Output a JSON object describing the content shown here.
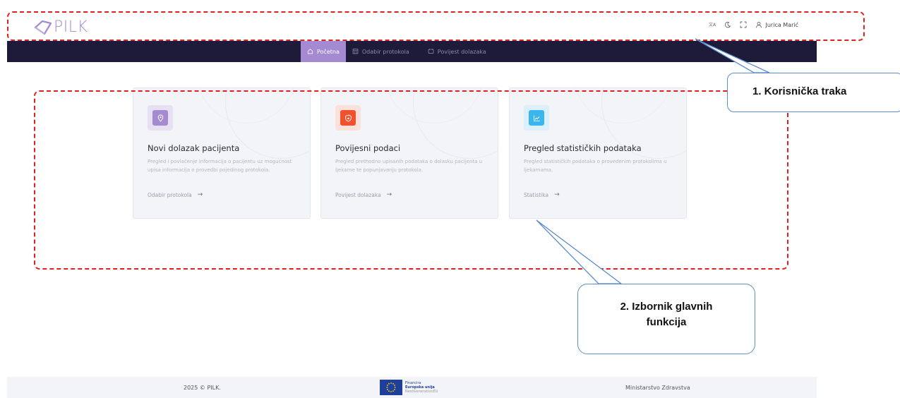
{
  "app": {
    "logo_text": "PILK"
  },
  "header": {
    "user_name": "Jurica Marić",
    "icons": [
      "translate-icon",
      "moon-icon",
      "fullscreen-icon",
      "user-icon"
    ]
  },
  "nav": {
    "items": [
      {
        "label": "Početna",
        "icon": "home-icon",
        "active": true
      },
      {
        "label": "Odabir protokola",
        "icon": "calendar-icon",
        "active": false
      },
      {
        "label": "Povijest dolazaka",
        "icon": "history-icon",
        "active": false
      }
    ]
  },
  "cards": [
    {
      "title": "Novi dolazak pacijenta",
      "description": "Pregled i povlačenje informacija o pacijentu uz mogućnost upisa informacija o provedbi pojedinog protokola.",
      "link": "Odabir protokola",
      "icon": "location-pin-icon",
      "icon_bg": "#e7e0f2",
      "icon_color": "#a48ad0"
    },
    {
      "title": "Povijesni podaci",
      "description": "Pregled prethodno upisanih podataka o dolasku pacijenta u ljekarne te popunjavanju protokola.",
      "link": "Povijest dolazaka",
      "icon": "shield-icon",
      "icon_bg": "#fbe1dc",
      "icon_color": "#f2512d"
    },
    {
      "title": "Pregled statističkih podataka",
      "description": "Pregled statističkih podataka o provedenim protokolima u ljekarnama.",
      "link": "Statistika",
      "icon": "chart-line-icon",
      "icon_bg": "#dcf0fa",
      "icon_color": "#3ab6ec"
    }
  ],
  "annotations": {
    "callout_1": "1. Korisnička traka",
    "callout_2_line1": "2. Izbornik glavnih",
    "callout_2_line2": "funkcija",
    "border_color": "#e02020",
    "callout_border_color": "#5b8ccc"
  },
  "footer": {
    "copyright": "2025 © PILK.",
    "eu_line1": "Financira",
    "eu_line2": "Europska unija",
    "eu_line3": "NextGenerationEU",
    "ministry": "Ministarstvo Zdravstva"
  }
}
